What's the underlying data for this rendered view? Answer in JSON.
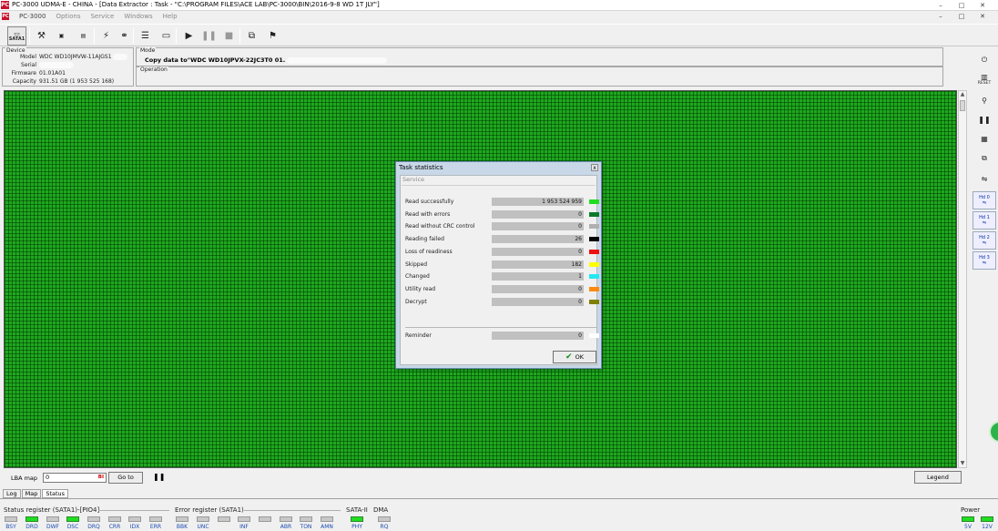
{
  "window": {
    "app_icon": "PC",
    "title": "PC-3000 UDMA-E - CHINA - [Data Extractor : Task - \"C:\\PROGRAM FILES\\ACE LAB\\PC-3000\\BIN\\2016-9-8 WD 1T JLY\"]",
    "controls": [
      "–",
      "□",
      "✕"
    ],
    "child_controls": [
      "–",
      "□",
      "✕"
    ]
  },
  "menu": {
    "logo": "PC",
    "items": [
      "PC-3000",
      "Options",
      "Service",
      "Windows",
      "Help"
    ]
  },
  "toolbar": {
    "sata_label": "SATA1",
    "icons": [
      "sata1-icon",
      "tools-icon",
      "chip-icon",
      "calculator-icon",
      "plug-icon",
      "binoculars-icon",
      "drive-stack-icon",
      "screen-icon",
      "play-icon",
      "pause-icon",
      "stop-icon",
      "copy-icon",
      "map-icon"
    ]
  },
  "device": {
    "title": "Device",
    "model_label": "Model",
    "model_value": "WDC WD10JMVW-11AJGS1",
    "serial_label": "Serial",
    "serial_value": "",
    "firmware_label": "Firmware",
    "firmware_value": "01.01A01",
    "capacity_label": "Capacity",
    "capacity_value": "931.51 GB (1 953 525 168)"
  },
  "mode": {
    "title": "Mode",
    "value": "Copy data to\"WDC WD10JPVX-22JC3T0 01."
  },
  "operation": {
    "title": "Operation"
  },
  "dialog": {
    "title": "Task statistics",
    "close": "x",
    "service_label": "Service",
    "rows": [
      {
        "label": "Read successfully",
        "value": "1 953 524 959",
        "color": "#22dd22"
      },
      {
        "label": "Read with errors",
        "value": "0",
        "color": "#0a7a2a"
      },
      {
        "label": "Read without CRC control",
        "value": "0",
        "color": "#b0b0b0"
      },
      {
        "label": "Reading failed",
        "value": "26",
        "color": "#000000"
      },
      {
        "label": "Loss of readiness",
        "value": "0",
        "color": "#ee1111"
      },
      {
        "label": "Skipped",
        "value": "182",
        "color": "#ffff00"
      },
      {
        "label": "Changed",
        "value": "1",
        "color": "#22e8f0"
      },
      {
        "label": "Utility read",
        "value": "0",
        "color": "#ff8a10"
      },
      {
        "label": "Decrypt",
        "value": "0",
        "color": "#808000"
      }
    ],
    "reminder": {
      "label": "Reminder",
      "value": "0",
      "color": "#ffffff"
    },
    "ok_label": "OK"
  },
  "bottom": {
    "lba_label": "LBA map",
    "lba_value": "0",
    "lba_suffix": "BI",
    "goto_label": "Go to",
    "legend_label": "Legend",
    "tabs": [
      "Log",
      "Map",
      "Status"
    ]
  },
  "status_register": {
    "title": "Status register (SATA1)-[PIO4]",
    "leds": [
      {
        "label": "BSY",
        "on": false
      },
      {
        "label": "DRD",
        "on": true
      },
      {
        "label": "DWF",
        "on": false
      },
      {
        "label": "DSC",
        "on": true
      },
      {
        "label": "DRQ",
        "on": false
      },
      {
        "label": "CRR",
        "on": false
      },
      {
        "label": "IDX",
        "on": false
      },
      {
        "label": "ERR",
        "on": false
      }
    ]
  },
  "error_register": {
    "title": "Error register (SATA1)",
    "leds": [
      {
        "label": "BBK",
        "on": false
      },
      {
        "label": "UNC",
        "on": false
      },
      {
        "label": "",
        "on": false
      },
      {
        "label": "INF",
        "on": false
      },
      {
        "label": "",
        "on": false
      },
      {
        "label": "ABR",
        "on": false
      },
      {
        "label": "TON",
        "on": false
      },
      {
        "label": "AMN",
        "on": false
      }
    ]
  },
  "sata2": {
    "title": "SATA-II",
    "leds": [
      {
        "label": "PHY",
        "on": true
      }
    ]
  },
  "dma": {
    "title": "DMA",
    "leds": [
      {
        "label": "RQ",
        "on": false
      }
    ]
  },
  "power": {
    "title": "Power",
    "leds": [
      {
        "label": "5V",
        "on": true
      },
      {
        "label": "12V",
        "on": true
      }
    ]
  },
  "right_toolbar": {
    "items": [
      "power-icon",
      "reset-icon",
      "pin-icon",
      "pause-icon",
      "counter-icon",
      "copy-icon",
      "connector-icon",
      "hd0-icon",
      "hd1-icon",
      "hd2-icon",
      "hd3-icon"
    ],
    "reset_label": "RESET",
    "hd_labels": [
      "Hd 0",
      "Hd 1",
      "Hd 2",
      "Hd 3"
    ]
  }
}
